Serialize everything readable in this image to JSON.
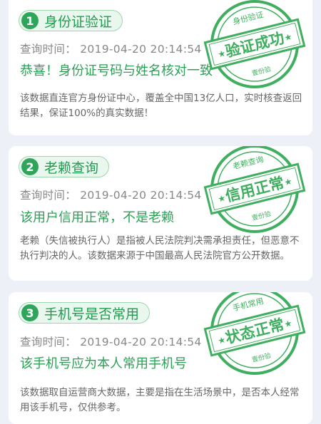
{
  "colors": {
    "accent": "#2ea55b",
    "stamp": "#3fae5e",
    "text_gray": "#888888",
    "background": "#eef0f7"
  },
  "cards": [
    {
      "number": "1",
      "title": "身份证验证",
      "query_time": "查询时间：  2019-04-20 20:14:54",
      "result": "恭喜！身份证号码与姓名核对一致",
      "description": "该数据直连官方身份证中心，覆盖全中国13亿人口，实时核查返回结果，保证100%的真实数据！",
      "stamp_top": "身份验证",
      "stamp_main": "验证成功",
      "stamp_bottom": "壹份验"
    },
    {
      "number": "2",
      "title": "老赖查询",
      "query_time": "查询时间：  2019-04-20 20:14:54",
      "result": "该用户信用正常，不是老赖",
      "description": "老赖（失信被执行人）是指被人民法院判决需承担责任，但恶意不执行判决的人。该数据来源于中国最高人民法院官方公开数据。",
      "stamp_top": "老赖查询",
      "stamp_main": "信用正常",
      "stamp_bottom": "壹份验"
    },
    {
      "number": "3",
      "title": "手机号是否常用",
      "query_time": "查询时间：  2019-04-20 20:14:54",
      "result": "该手机号应为本人常用手机号",
      "description": "该数据取自运营商大数据，主要是指在生活场景中，是否本人经常用该手机号，仅供参考。",
      "stamp_top": "手机常用",
      "stamp_main": "状态正常",
      "stamp_bottom": "壹份验"
    }
  ]
}
